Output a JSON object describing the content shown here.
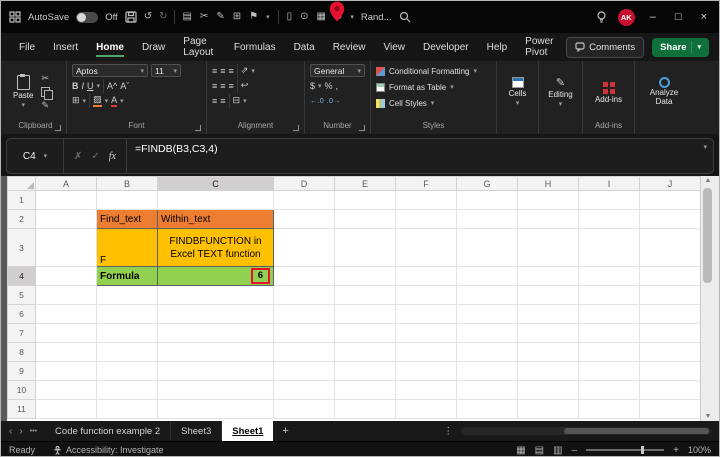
{
  "titlebar": {
    "autosave_label": "AutoSave",
    "autosave_state": "Off",
    "quick_label": "Rand...",
    "avatar_initials": "AK"
  },
  "menubar": {
    "tabs": [
      "File",
      "Insert",
      "Home",
      "Draw",
      "Page Layout",
      "Formulas",
      "Data",
      "Review",
      "View",
      "Developer",
      "Help",
      "Power Pivot"
    ],
    "active_tab": "Home",
    "comments_label": "Comments",
    "share_label": "Share"
  },
  "ribbon": {
    "paste_label": "Paste",
    "font_name": "Aptos",
    "font_size": "11",
    "bold": "B",
    "italic": "I",
    "underline": "U",
    "font_grow": "A^",
    "font_shrink": "Aˇ",
    "font_color_letter": "A",
    "fill_icon": "▨",
    "number_format": "General",
    "conditional_formatting": "Conditional Formatting",
    "format_as_table": "Format as Table",
    "cell_styles": "Cell Styles",
    "cells_label": "Cells",
    "editing_label": "Editing",
    "addins_label": "Add-ins",
    "analyze_label": "Analyze Data",
    "group_labels": [
      "Clipboard",
      "Font",
      "Alignment",
      "Number",
      "Styles",
      "Add-ins"
    ]
  },
  "formula_bar": {
    "name_box": "C4",
    "formula": "=FINDB(B3,C3,4)"
  },
  "grid": {
    "col_headers": [
      "A",
      "B",
      "C",
      "D",
      "E",
      "F",
      "G",
      "H",
      "I",
      "J"
    ],
    "row_headers": [
      "1",
      "2",
      "3",
      "4",
      "5",
      "6",
      "7",
      "8",
      "9",
      "10",
      "11"
    ],
    "selected_col": "C",
    "selected_row": "4",
    "cells": {
      "b2": "Find_text",
      "c2": "Within_text",
      "b3": "F",
      "c3_line1": "FINDBFUNCTION in",
      "c3_line2": "Excel TEXT function",
      "b4": "Formula",
      "c4": "6"
    }
  },
  "tabs_bar": {
    "sheets": [
      "Code function example 2",
      "Sheet3",
      "Sheet1"
    ],
    "active": "Sheet1",
    "add": "+"
  },
  "status_bar": {
    "ready": "Ready",
    "accessibility": "Accessibility: Investigate",
    "zoom": "100%"
  },
  "icons": {
    "caret": "▾",
    "undo": "↺",
    "redo": "↻",
    "clipboard": "▤",
    "cut": "✂",
    "brush": "✎",
    "table": "⊞",
    "flag": "⚑",
    "document": "▯",
    "camera": "⊙",
    "chart": "▦",
    "add_user": "⊕",
    "minimize": "–",
    "maximize": "□",
    "close": "×",
    "check": "✓",
    "cross": "✗",
    "fx": "fx",
    "align": "≡",
    "orientation": "⇗",
    "wrap": "↩",
    "merge": "⊟",
    "borders": "⊞",
    "dollar": "$",
    "percent": "%",
    "comma": ",",
    "dec_left": "←.0",
    "dec_right": ".0→",
    "pencil": "✎",
    "chev_left": "‹",
    "chev_right": "›",
    "hdots": "•••",
    "vdots": "⋮",
    "normal_view": "▦",
    "layout_view": "▤",
    "break_view": "▥",
    "zoom_out": "–",
    "zoom_in": "+"
  },
  "colors": {
    "fill_orange": "#ED7D31",
    "fill_yellow": "#FFC000",
    "fill_green": "#92D050",
    "share_green": "#0F703B",
    "accent_green": "#4EA671",
    "annotation_red": "#E8112D",
    "avatar_red": "#C8102E",
    "selected_header_gray": "#D0CECE"
  }
}
